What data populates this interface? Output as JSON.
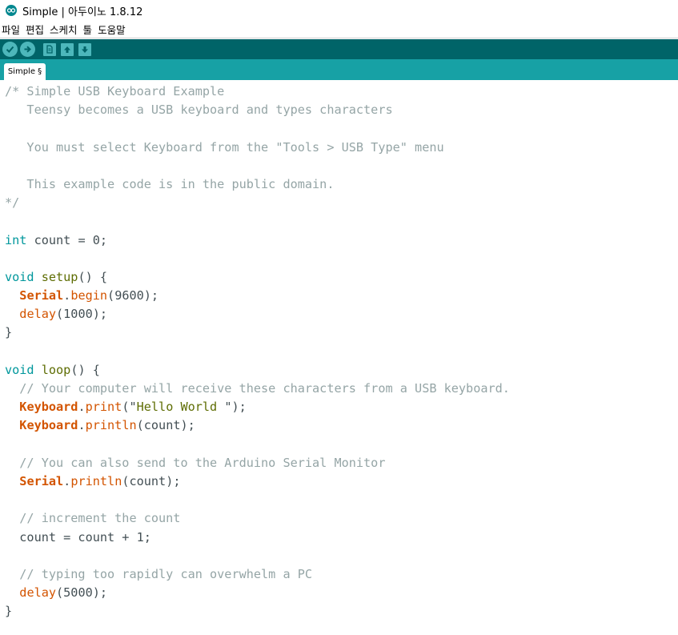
{
  "window": {
    "title": "Simple | 아두이노 1.8.12"
  },
  "menubar": {
    "items": [
      "파일",
      "편집",
      "스케치",
      "툴",
      "도움말"
    ]
  },
  "toolbar": {
    "buttons": [
      {
        "name": "verify",
        "icon": "check-icon"
      },
      {
        "name": "upload",
        "icon": "arrow-right-icon"
      },
      {
        "name": "new",
        "icon": "new-file-icon"
      },
      {
        "name": "open",
        "icon": "arrow-up-icon"
      },
      {
        "name": "save",
        "icon": "arrow-down-icon"
      }
    ]
  },
  "tabs": [
    {
      "label": "Simple §"
    }
  ],
  "editor": {
    "lines": [
      [
        {
          "t": "/* Simple USB Keyboard Example",
          "c": "cmt"
        }
      ],
      [
        {
          "t": "   Teensy becomes a USB keyboard and types characters",
          "c": "cmt"
        }
      ],
      [
        {
          "t": "",
          "c": ""
        }
      ],
      [
        {
          "t": "   You must select Keyboard from the \"Tools > USB Type\" menu",
          "c": "cmt"
        }
      ],
      [
        {
          "t": "",
          "c": ""
        }
      ],
      [
        {
          "t": "   This example code is in the public domain.",
          "c": "cmt"
        }
      ],
      [
        {
          "t": "*/",
          "c": "cmt"
        }
      ],
      [
        {
          "t": "",
          "c": ""
        }
      ],
      [
        {
          "t": "int",
          "c": "ty"
        },
        {
          "t": " count = 0;",
          "c": ""
        }
      ],
      [
        {
          "t": "",
          "c": ""
        }
      ],
      [
        {
          "t": "void",
          "c": "ty"
        },
        {
          "t": " ",
          "c": ""
        },
        {
          "t": "setup",
          "c": "usr"
        },
        {
          "t": "() {",
          "c": ""
        }
      ],
      [
        {
          "t": "  ",
          "c": ""
        },
        {
          "t": "Serial",
          "c": "cls"
        },
        {
          "t": ".",
          "c": ""
        },
        {
          "t": "begin",
          "c": "fn"
        },
        {
          "t": "(9600);",
          "c": ""
        }
      ],
      [
        {
          "t": "  ",
          "c": ""
        },
        {
          "t": "delay",
          "c": "fn"
        },
        {
          "t": "(1000);",
          "c": ""
        }
      ],
      [
        {
          "t": "}",
          "c": ""
        }
      ],
      [
        {
          "t": "",
          "c": ""
        }
      ],
      [
        {
          "t": "void",
          "c": "ty"
        },
        {
          "t": " ",
          "c": ""
        },
        {
          "t": "loop",
          "c": "usr"
        },
        {
          "t": "() {",
          "c": ""
        }
      ],
      [
        {
          "t": "  // Your computer will receive these characters from a USB keyboard.",
          "c": "cmt"
        }
      ],
      [
        {
          "t": "  ",
          "c": ""
        },
        {
          "t": "Keyboard",
          "c": "cls"
        },
        {
          "t": ".",
          "c": ""
        },
        {
          "t": "print",
          "c": "fn"
        },
        {
          "t": "(\"",
          "c": ""
        },
        {
          "t": "Hello World ",
          "c": "usr"
        },
        {
          "t": "\");",
          "c": ""
        }
      ],
      [
        {
          "t": "  ",
          "c": ""
        },
        {
          "t": "Keyboard",
          "c": "cls"
        },
        {
          "t": ".",
          "c": ""
        },
        {
          "t": "println",
          "c": "fn"
        },
        {
          "t": "(count);",
          "c": ""
        }
      ],
      [
        {
          "t": "",
          "c": ""
        }
      ],
      [
        {
          "t": "  // You can also send to the Arduino Serial Monitor",
          "c": "cmt"
        }
      ],
      [
        {
          "t": "  ",
          "c": ""
        },
        {
          "t": "Serial",
          "c": "cls"
        },
        {
          "t": ".",
          "c": ""
        },
        {
          "t": "println",
          "c": "fn"
        },
        {
          "t": "(count);",
          "c": ""
        }
      ],
      [
        {
          "t": "",
          "c": ""
        }
      ],
      [
        {
          "t": "  // increment the count",
          "c": "cmt"
        }
      ],
      [
        {
          "t": "  count = count + 1;",
          "c": ""
        }
      ],
      [
        {
          "t": "",
          "c": ""
        }
      ],
      [
        {
          "t": "  // typing too rapidly can overwhelm a PC",
          "c": "cmt"
        }
      ],
      [
        {
          "t": "  ",
          "c": ""
        },
        {
          "t": "delay",
          "c": "fn"
        },
        {
          "t": "(5000);",
          "c": ""
        }
      ],
      [
        {
          "t": "}",
          "c": ""
        }
      ]
    ]
  },
  "colors": {
    "toolbar_bg": "#006468",
    "tabbar_bg": "#17a1a5",
    "button_bg": "#4db7bb",
    "comment": "#95a5a6",
    "type_keyword": "#00979c",
    "function": "#d35400",
    "user_function": "#5e6d03",
    "default_text": "#434f54"
  }
}
